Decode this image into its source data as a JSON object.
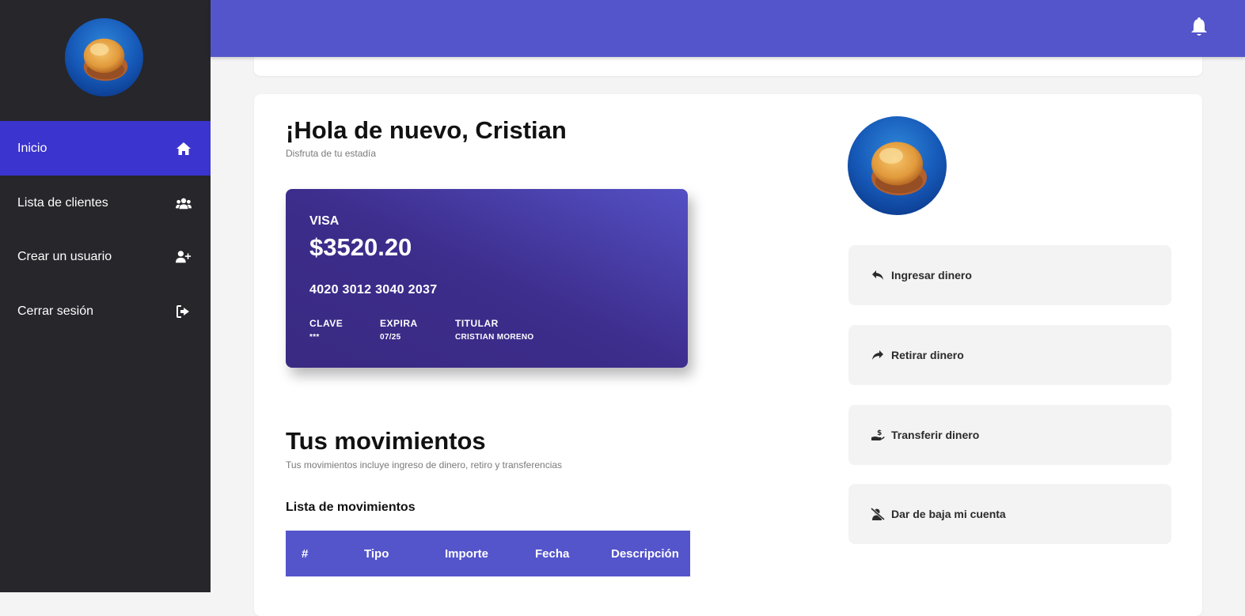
{
  "sidebar": {
    "avatar": "jellyfish-avatar",
    "items": [
      {
        "label": "Inicio",
        "icon": "home-icon",
        "active": true
      },
      {
        "label": "Lista de clientes",
        "icon": "users-icon",
        "active": false
      },
      {
        "label": "Crear un usuario",
        "icon": "user-plus-icon",
        "active": false
      },
      {
        "label": "Cerrar sesión",
        "icon": "sign-out-icon",
        "active": false
      }
    ]
  },
  "topbar": {
    "icon": "bell-icon"
  },
  "greeting": {
    "title": "¡Hola de nuevo, Cristian",
    "subtitle": "Disfruta de tu estadía"
  },
  "card": {
    "brand": "VISA",
    "balance": "$3520.20",
    "number": "4020 3012 3040 2037",
    "clave_label": "CLAVE",
    "clave_value": "***",
    "expira_label": "EXPIRA",
    "expira_value": "07/25",
    "titular_label": "TITULAR",
    "titular_value": "CRISTIAN MORENO"
  },
  "movements": {
    "title": "Tus movimientos",
    "subtitle": "Tus movimientos incluye ingreso de dinero, retiro y transferencias",
    "list_title": "Lista de movimientos",
    "columns": [
      "#",
      "Tipo",
      "Importe",
      "Fecha",
      "Descripción"
    ]
  },
  "actions": [
    {
      "label": "Ingresar dinero",
      "icon": "reply-icon"
    },
    {
      "label": "Retirar dinero",
      "icon": "share-icon"
    },
    {
      "label": "Transferir dinero",
      "icon": "hand-holding-dollar-icon"
    },
    {
      "label": "Dar de baja mi cuenta",
      "icon": "user-slash-icon"
    }
  ],
  "colors": {
    "sidebar": "#26262b",
    "accent": "#5455cb",
    "active_nav": "#3b34cf",
    "card_gradient_start": "#5450c4",
    "card_gradient_end": "#392a82"
  }
}
